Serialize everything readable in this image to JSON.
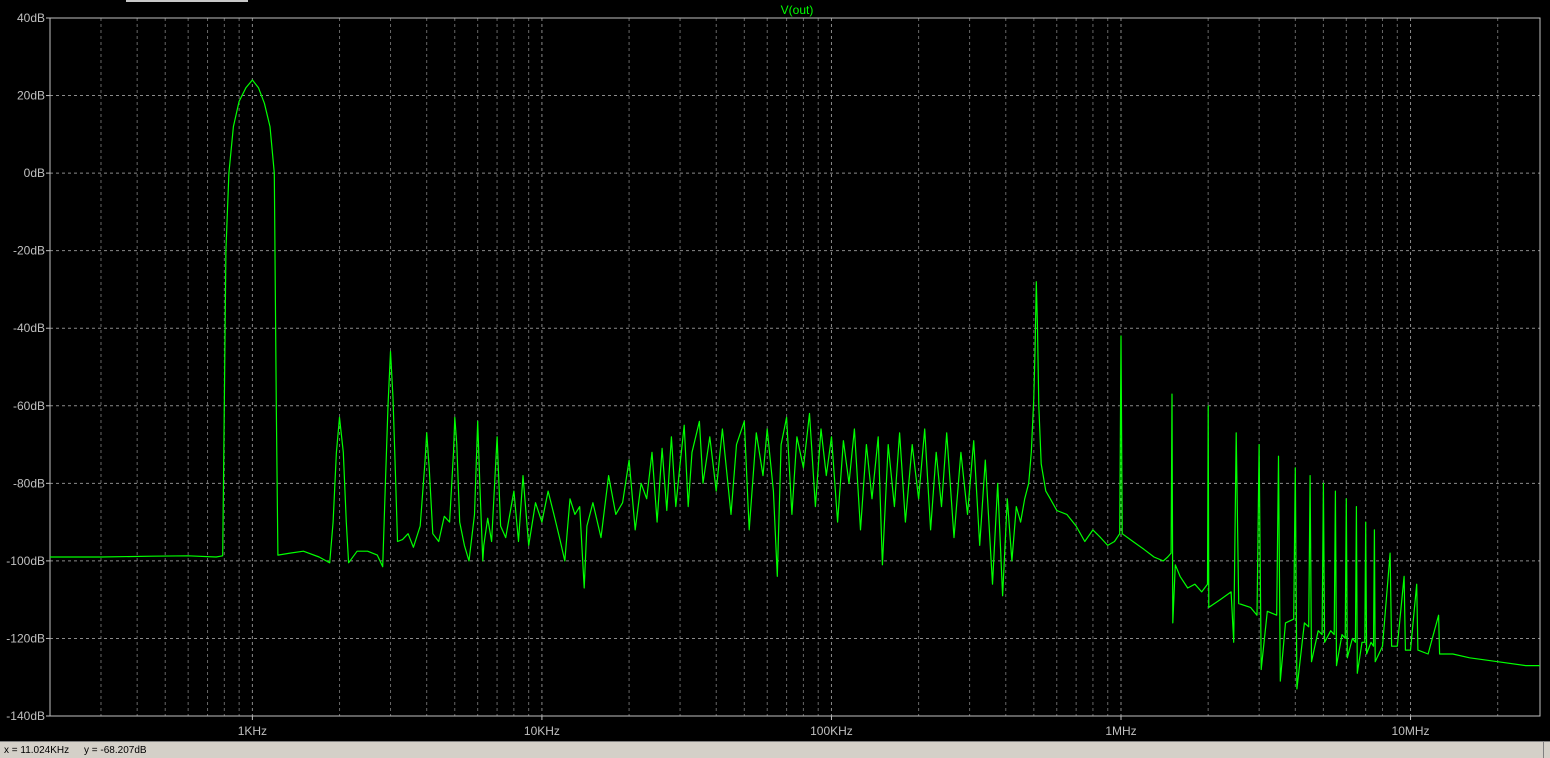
{
  "status": {
    "x_label": "x = 11.024KHz",
    "y_label": "y = -68.207dB"
  },
  "colors": {
    "background": "#000000",
    "trace": "#00ff00",
    "axis": "#c0c0c0",
    "grid": "#8a8a8a",
    "title": "#00ff00"
  },
  "chart_data": {
    "type": "line",
    "title": "V(out)",
    "xscale": "log",
    "xlim_hz": [
      200,
      28000000
    ],
    "ylim_db": [
      -140,
      40
    ],
    "grid": "dashed on",
    "x_ticks": [
      {
        "value": 1000,
        "label": "1KHz"
      },
      {
        "value": 10000,
        "label": "10KHz"
      },
      {
        "value": 100000,
        "label": "100KHz"
      },
      {
        "value": 1000000,
        "label": "1MHz"
      },
      {
        "value": 10000000,
        "label": "10MHz"
      }
    ],
    "y_ticks": [
      {
        "value": 40,
        "label": "40dB"
      },
      {
        "value": 20,
        "label": "20dB"
      },
      {
        "value": 0,
        "label": "0dB"
      },
      {
        "value": -20,
        "label": "-20dB"
      },
      {
        "value": -40,
        "label": "-40dB"
      },
      {
        "value": -60,
        "label": "-60dB"
      },
      {
        "value": -80,
        "label": "-80dB"
      },
      {
        "value": -100,
        "label": "-100dB"
      },
      {
        "value": -120,
        "label": "-120dB"
      },
      {
        "value": -140,
        "label": "-140dB"
      }
    ],
    "series": [
      {
        "name": "V(out)",
        "points": [
          [
            200,
            -99
          ],
          [
            300,
            -99
          ],
          [
            450,
            -98.8
          ],
          [
            600,
            -98.7
          ],
          [
            750,
            -99
          ],
          [
            790,
            -98.7
          ],
          [
            800,
            -60
          ],
          [
            810,
            -20
          ],
          [
            830,
            0
          ],
          [
            860,
            12
          ],
          [
            900,
            18.5
          ],
          [
            950,
            22
          ],
          [
            1000,
            24
          ],
          [
            1050,
            22
          ],
          [
            1100,
            18
          ],
          [
            1150,
            12
          ],
          [
            1190,
            0
          ],
          [
            1210,
            -60
          ],
          [
            1225,
            -98.5
          ],
          [
            1350,
            -98
          ],
          [
            1500,
            -97.5
          ],
          [
            1700,
            -99
          ],
          [
            1850,
            -100.5
          ],
          [
            1900,
            -90
          ],
          [
            1950,
            -72
          ],
          [
            2000,
            -63
          ],
          [
            2060,
            -72
          ],
          [
            2110,
            -90
          ],
          [
            2150,
            -100.5
          ],
          [
            2300,
            -97.5
          ],
          [
            2500,
            -97.5
          ],
          [
            2700,
            -98.5
          ],
          [
            2820,
            -101.5
          ],
          [
            2880,
            -80
          ],
          [
            2940,
            -60
          ],
          [
            3000,
            -46
          ],
          [
            3060,
            -58
          ],
          [
            3120,
            -78
          ],
          [
            3170,
            -95
          ],
          [
            3300,
            -94.5
          ],
          [
            3450,
            -93
          ],
          [
            3600,
            -96.5
          ],
          [
            3800,
            -91
          ],
          [
            3950,
            -74
          ],
          [
            4000,
            -67
          ],
          [
            4080,
            -76
          ],
          [
            4200,
            -93
          ],
          [
            4400,
            -95
          ],
          [
            4600,
            -88.5
          ],
          [
            4800,
            -90
          ],
          [
            4950,
            -72
          ],
          [
            5000,
            -63
          ],
          [
            5080,
            -70
          ],
          [
            5200,
            -90
          ],
          [
            5400,
            -96
          ],
          [
            5600,
            -100
          ],
          [
            5850,
            -88
          ],
          [
            6000,
            -64
          ],
          [
            6100,
            -80
          ],
          [
            6250,
            -100
          ],
          [
            6300,
            -96
          ],
          [
            6500,
            -89
          ],
          [
            6700,
            -95
          ],
          [
            7000,
            -68
          ],
          [
            7200,
            -91
          ],
          [
            7500,
            -94
          ],
          [
            8000,
            -82
          ],
          [
            8300,
            -95
          ],
          [
            8600,
            -78
          ],
          [
            9000,
            -96
          ],
          [
            9500,
            -85
          ],
          [
            10000,
            -90
          ],
          [
            10500,
            -82
          ],
          [
            11000,
            -88
          ],
          [
            11500,
            -94
          ],
          [
            12000,
            -100
          ],
          [
            12500,
            -84
          ],
          [
            13000,
            -88
          ],
          [
            13500,
            -86
          ],
          [
            14000,
            -107
          ],
          [
            14300,
            -91
          ],
          [
            15000,
            -85
          ],
          [
            16000,
            -94
          ],
          [
            17000,
            -78
          ],
          [
            18000,
            -88
          ],
          [
            19000,
            -85
          ],
          [
            20000,
            -74
          ],
          [
            21000,
            -92
          ],
          [
            22000,
            -80
          ],
          [
            23000,
            -84
          ],
          [
            24000,
            -72
          ],
          [
            25000,
            -90
          ],
          [
            26000,
            -71
          ],
          [
            27000,
            -87
          ],
          [
            28000,
            -68
          ],
          [
            29000,
            -86
          ],
          [
            30000,
            -75
          ],
          [
            31000,
            -65
          ],
          [
            32000,
            -86
          ],
          [
            33000,
            -72
          ],
          [
            35000,
            -64
          ],
          [
            36000,
            -80
          ],
          [
            38000,
            -68
          ],
          [
            40000,
            -82
          ],
          [
            42000,
            -66
          ],
          [
            45000,
            -88
          ],
          [
            47000,
            -70
          ],
          [
            50000,
            -64
          ],
          [
            52000,
            -92
          ],
          [
            55000,
            -67
          ],
          [
            58000,
            -78
          ],
          [
            60000,
            -66
          ],
          [
            63000,
            -82
          ],
          [
            65000,
            -104
          ],
          [
            67000,
            -70
          ],
          [
            70000,
            -63
          ],
          [
            73000,
            -88
          ],
          [
            76000,
            -68
          ],
          [
            80000,
            -76
          ],
          [
            84000,
            -62
          ],
          [
            88000,
            -86
          ],
          [
            92000,
            -66
          ],
          [
            96000,
            -78
          ],
          [
            100000,
            -68
          ],
          [
            105000,
            -90
          ],
          [
            110000,
            -69
          ],
          [
            115000,
            -80
          ],
          [
            120000,
            -66
          ],
          [
            126000,
            -92
          ],
          [
            132000,
            -70
          ],
          [
            138000,
            -84
          ],
          [
            145000,
            -68
          ],
          [
            150000,
            -101
          ],
          [
            157000,
            -70
          ],
          [
            165000,
            -86
          ],
          [
            172000,
            -67
          ],
          [
            180000,
            -90
          ],
          [
            190000,
            -70
          ],
          [
            200000,
            -84
          ],
          [
            210000,
            -66
          ],
          [
            220000,
            -92
          ],
          [
            230000,
            -72
          ],
          [
            240000,
            -86
          ],
          [
            250000,
            -67
          ],
          [
            265000,
            -94
          ],
          [
            280000,
            -72
          ],
          [
            295000,
            -88
          ],
          [
            310000,
            -69
          ],
          [
            325000,
            -96
          ],
          [
            340000,
            -74
          ],
          [
            360000,
            -106
          ],
          [
            375000,
            -80
          ],
          [
            390000,
            -109
          ],
          [
            405000,
            -84
          ],
          [
            420000,
            -100
          ],
          [
            435000,
            -86
          ],
          [
            450000,
            -90
          ],
          [
            465000,
            -84
          ],
          [
            480000,
            -80
          ],
          [
            490000,
            -72
          ],
          [
            500000,
            -58
          ],
          [
            505000,
            -45
          ],
          [
            510000,
            -28
          ],
          [
            515000,
            -40
          ],
          [
            520000,
            -60
          ],
          [
            530000,
            -75
          ],
          [
            550000,
            -82
          ],
          [
            570000,
            -84
          ],
          [
            600000,
            -87
          ],
          [
            650000,
            -88
          ],
          [
            700000,
            -91
          ],
          [
            750000,
            -95
          ],
          [
            800000,
            -92
          ],
          [
            850000,
            -94
          ],
          [
            900000,
            -96
          ],
          [
            950000,
            -95
          ],
          [
            990000,
            -93
          ],
          [
            1000000,
            -42
          ],
          [
            1010000,
            -93
          ],
          [
            1100000,
            -95
          ],
          [
            1200000,
            -97
          ],
          [
            1300000,
            -99
          ],
          [
            1400000,
            -100
          ],
          [
            1450000,
            -99
          ],
          [
            1490000,
            -98
          ],
          [
            1500000,
            -57
          ],
          [
            1510000,
            -116
          ],
          [
            1540000,
            -101
          ],
          [
            1600000,
            -104
          ],
          [
            1700000,
            -107
          ],
          [
            1800000,
            -106
          ],
          [
            1900000,
            -108
          ],
          [
            1990000,
            -106
          ],
          [
            2000000,
            -60
          ],
          [
            2010000,
            -112
          ],
          [
            2200000,
            -110
          ],
          [
            2400000,
            -108
          ],
          [
            2450000,
            -121
          ],
          [
            2500000,
            -67
          ],
          [
            2550000,
            -111
          ],
          [
            2800000,
            -112
          ],
          [
            2950000,
            -114
          ],
          [
            3000000,
            -70
          ],
          [
            3050000,
            -128
          ],
          [
            3200000,
            -113
          ],
          [
            3450000,
            -114
          ],
          [
            3500000,
            -73
          ],
          [
            3550000,
            -131
          ],
          [
            3700000,
            -116
          ],
          [
            3950000,
            -115
          ],
          [
            4000000,
            -76
          ],
          [
            4050000,
            -133
          ],
          [
            4300000,
            -116
          ],
          [
            4450000,
            -117
          ],
          [
            4500000,
            -78
          ],
          [
            4550000,
            -126
          ],
          [
            4800000,
            -118
          ],
          [
            4950000,
            -119
          ],
          [
            5000000,
            -80
          ],
          [
            5050000,
            -121
          ],
          [
            5300000,
            -118
          ],
          [
            5450000,
            -119
          ],
          [
            5500000,
            -82
          ],
          [
            5550000,
            -127
          ],
          [
            5800000,
            -119
          ],
          [
            5950000,
            -120
          ],
          [
            6000000,
            -84
          ],
          [
            6050000,
            -125
          ],
          [
            6300000,
            -120
          ],
          [
            6450000,
            -121
          ],
          [
            6500000,
            -86
          ],
          [
            6550000,
            -129
          ],
          [
            6800000,
            -121
          ],
          [
            6950000,
            -121
          ],
          [
            7000000,
            -90
          ],
          [
            7050000,
            -124
          ],
          [
            7300000,
            -121
          ],
          [
            7450000,
            -122
          ],
          [
            7500000,
            -92
          ],
          [
            7550000,
            -126
          ],
          [
            8000000,
            -122
          ],
          [
            8500000,
            -98
          ],
          [
            8600000,
            -122
          ],
          [
            9000000,
            -122
          ],
          [
            9500000,
            -104
          ],
          [
            9600000,
            -123
          ],
          [
            10000000,
            -123
          ],
          [
            10500000,
            -106
          ],
          [
            10600000,
            -123
          ],
          [
            11500000,
            -124
          ],
          [
            12500000,
            -114
          ],
          [
            12600000,
            -124
          ],
          [
            14000000,
            -124
          ],
          [
            16000000,
            -125
          ],
          [
            20000000,
            -126
          ],
          [
            25000000,
            -127
          ],
          [
            28000000,
            -127
          ]
        ]
      }
    ]
  }
}
